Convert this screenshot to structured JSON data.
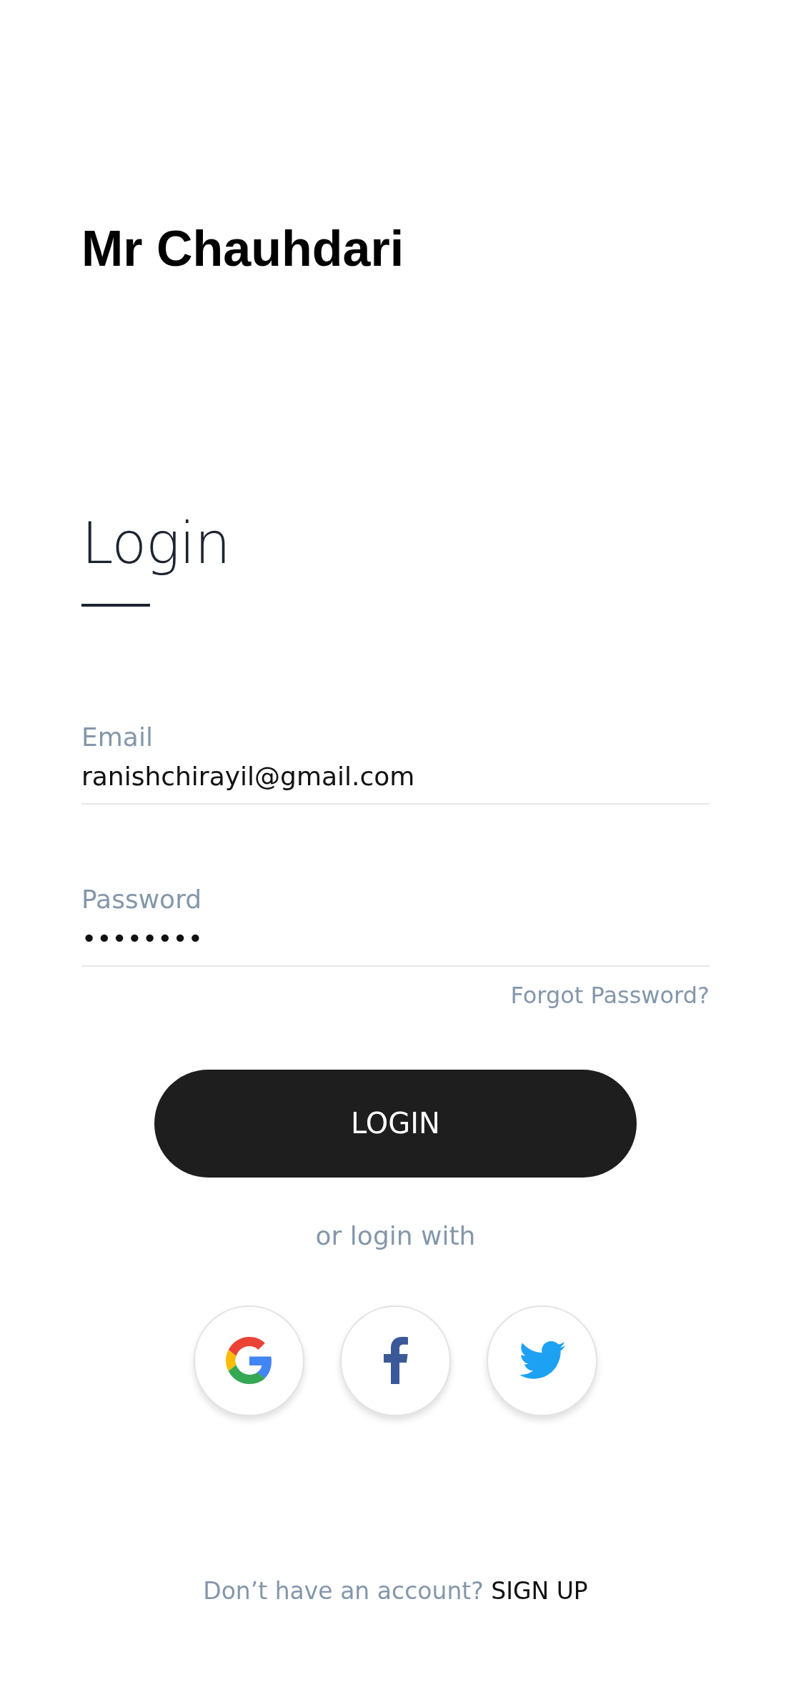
{
  "brand": "Mr Chauhdari",
  "heading": "Login",
  "fields": [
    {
      "label": "Email",
      "value": "ranishchirayil@gmail.com"
    },
    {
      "label": "Password",
      "value": "••••••••"
    }
  ],
  "forgot_link": "Forgot Password?",
  "login_button": "LOGIN",
  "social_caption": "or login with",
  "social_buttons": [
    {
      "kind": "google"
    },
    {
      "kind": "facebook"
    },
    {
      "kind": "twitter"
    }
  ],
  "signup": {
    "prompt": "Don’t have an account?",
    "link": "SIGN UP"
  }
}
